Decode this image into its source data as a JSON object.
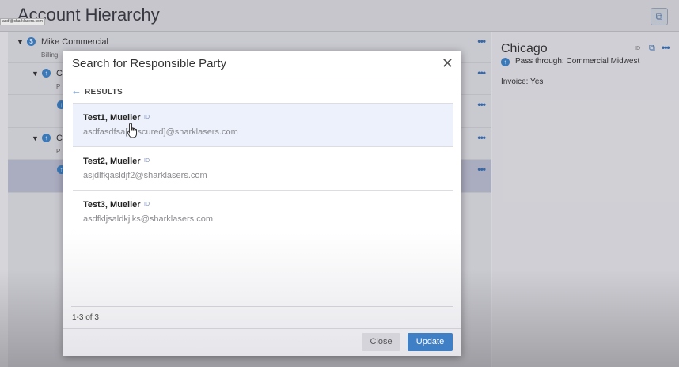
{
  "page": {
    "title": "Account Hierarchy",
    "tiny_email": "asdf@sharklasers.com"
  },
  "tree": {
    "root_label": "Mike Commercial",
    "root_sub": "Billing",
    "child1_label": "C",
    "child1_sub": "P",
    "child2_label": "C",
    "child2_sub": "P",
    "menu": "•••"
  },
  "detail": {
    "title": "Chicago",
    "id_badge": "ID",
    "pass_through": "Pass through: Commercial Midwest",
    "invoice": "Invoice: Yes",
    "menu": "•••"
  },
  "modal": {
    "title": "Search for Responsible Party",
    "results_label": "RESULTS",
    "results": [
      {
        "name": "Test1, Mueller",
        "id_badge": "ID",
        "email": "asdfasdfsa[obscured]@sharklasers.com"
      },
      {
        "name": "Test2, Mueller",
        "id_badge": "ID",
        "email": "asjdlfkjasldjf2@sharklasers.com"
      },
      {
        "name": "Test3, Mueller",
        "id_badge": "ID",
        "email": "asdfkljsaldkjlks@sharklasers.com"
      }
    ],
    "count": "1-3 of 3",
    "close_label": "Close",
    "update_label": "Update"
  },
  "colors": {
    "accent": "#3f7fc6",
    "hover_row": "#edf1fb"
  },
  "icons": {
    "header_button": "copy-window-icon",
    "back": "arrow-left-icon",
    "modal_close": "close-icon",
    "node": "circle-up-arrow-icon",
    "root": "dollar-circle-icon",
    "cursor": "hand-pointer-icon"
  }
}
